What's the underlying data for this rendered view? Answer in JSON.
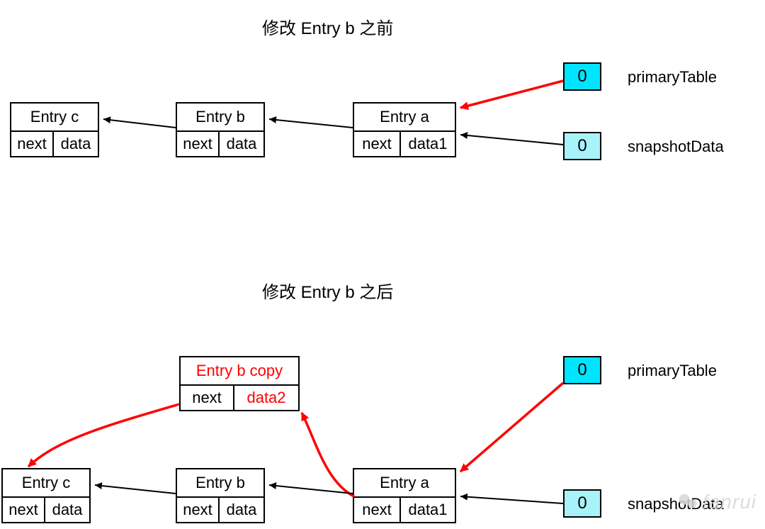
{
  "titles": {
    "before": "修改 Entry b 之前",
    "after": "修改 Entry b 之后"
  },
  "labels": {
    "primaryTable": "primaryTable",
    "snapshotData": "snapshotData"
  },
  "slots": {
    "primary_before": "0",
    "snapshot_before": "0",
    "primary_after": "0",
    "snapshot_after": "0"
  },
  "nodes": {
    "before": {
      "c": {
        "title": "Entry c",
        "next": "next",
        "data": "data"
      },
      "b": {
        "title": "Entry b",
        "next": "next",
        "data": "data"
      },
      "a": {
        "title": "Entry a",
        "next": "next",
        "data": "data1"
      }
    },
    "after": {
      "bcopy": {
        "title": "Entry b copy",
        "next": "next",
        "data": "data2"
      },
      "c": {
        "title": "Entry c",
        "next": "next",
        "data": "data"
      },
      "b": {
        "title": "Entry b",
        "next": "next",
        "data": "data"
      },
      "a": {
        "title": "Entry a",
        "next": "next",
        "data": "data1"
      }
    }
  },
  "colors": {
    "arrow_red": "#ff0000",
    "arrow_black": "#000000",
    "slot_primary": "#00e5ff",
    "slot_snapshot": "#a7f3f9"
  },
  "watermark": "fanrui"
}
